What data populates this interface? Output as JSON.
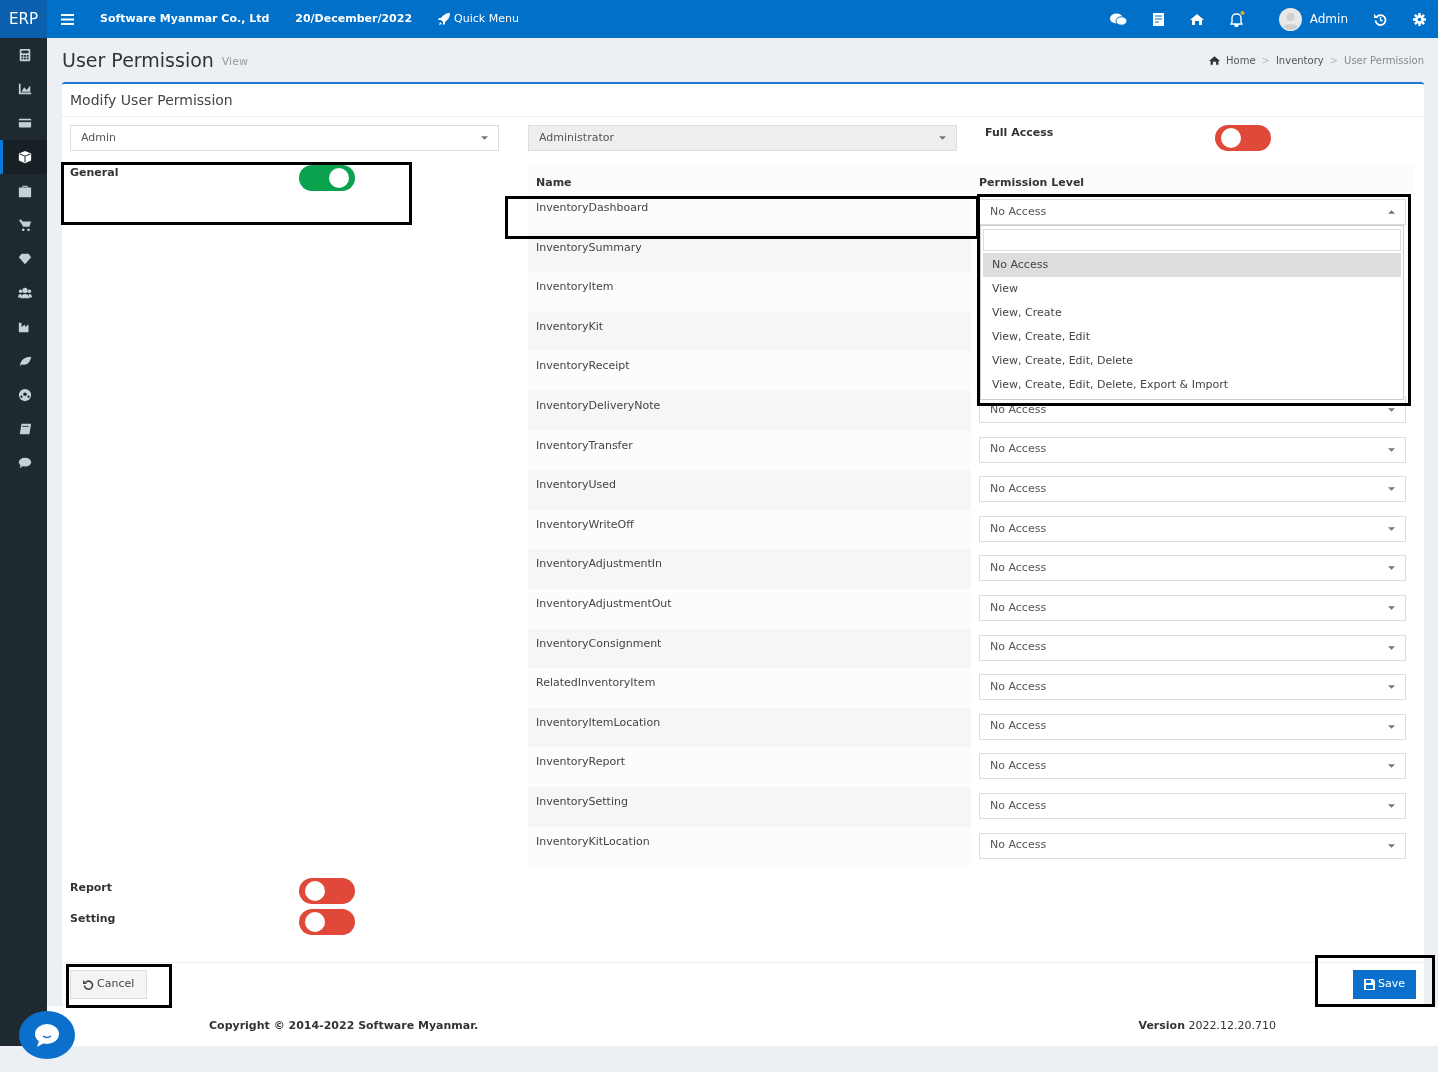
{
  "topbar": {
    "logo": "ERP",
    "company": "Software Myanmar Co., Ltd",
    "date": "20/December/2022",
    "quick_menu": "Quick Menu",
    "user": "Admin"
  },
  "sidebar": {
    "items": [
      {
        "kind": "calculator",
        "selected": false
      },
      {
        "kind": "chart",
        "selected": false
      },
      {
        "kind": "card",
        "selected": false
      },
      {
        "kind": "cube",
        "selected": true
      },
      {
        "kind": "briefcase",
        "selected": false
      },
      {
        "kind": "cart",
        "selected": false
      },
      {
        "kind": "diamond",
        "selected": false
      },
      {
        "kind": "users",
        "selected": false
      },
      {
        "kind": "factory",
        "selected": false
      },
      {
        "kind": "leaf",
        "selected": false
      },
      {
        "kind": "ball",
        "selected": false
      },
      {
        "kind": "book",
        "selected": false
      },
      {
        "kind": "comment",
        "selected": false
      }
    ]
  },
  "page": {
    "title": "User Permission",
    "subtitle": "View",
    "breadcrumb": [
      "Home",
      "Inventory",
      "User Permission"
    ],
    "breadcrumb_separators": [
      ">",
      ">"
    ]
  },
  "form": {
    "title": "Modify User Permission",
    "user_select": "Admin",
    "role_select": "Administrator",
    "full_access": {
      "label": "Full Access",
      "on": false
    },
    "modules": [
      {
        "label": "General",
        "on": true
      }
    ],
    "bottom_modules": [
      {
        "label": "Report",
        "on": false
      },
      {
        "label": "Setting",
        "on": false
      }
    ]
  },
  "table": {
    "columns": [
      "Name",
      "Permission Level"
    ],
    "rows": [
      {
        "name": "InventoryDashboard",
        "permission": "No Access",
        "expanded": true
      },
      {
        "name": "InventorySummary"
      },
      {
        "name": "InventoryItem"
      },
      {
        "name": "InventoryKit"
      },
      {
        "name": "InventoryReceipt"
      },
      {
        "name": "InventoryDeliveryNote",
        "permission": "No Access",
        "expanded": false
      },
      {
        "name": "InventoryTransfer",
        "permission": "No Access",
        "expanded": false
      },
      {
        "name": "InventoryUsed",
        "permission": "No Access",
        "expanded": false
      },
      {
        "name": "InventoryWriteOff",
        "permission": "No Access",
        "expanded": false
      },
      {
        "name": "InventoryAdjustmentIn",
        "permission": "No Access",
        "expanded": false
      },
      {
        "name": "InventoryAdjustmentOut",
        "permission": "No Access",
        "expanded": false
      },
      {
        "name": "InventoryConsignment",
        "permission": "No Access",
        "expanded": false
      },
      {
        "name": "RelatedInventoryItem",
        "permission": "No Access",
        "expanded": false
      },
      {
        "name": "InventoryItemLocation",
        "permission": "No Access",
        "expanded": false
      },
      {
        "name": "InventoryReport",
        "permission": "No Access",
        "expanded": false
      },
      {
        "name": "InventorySetting",
        "permission": "No Access",
        "expanded": false
      },
      {
        "name": "InventoryKitLocation",
        "permission": "No Access",
        "expanded": false
      }
    ],
    "dropdown_options": [
      {
        "label": "No Access",
        "selected": true
      },
      {
        "label": "View",
        "selected": false
      },
      {
        "label": "View, Create",
        "selected": false
      },
      {
        "label": "View, Create, Edit",
        "selected": false
      },
      {
        "label": "View, Create, Edit, Delete",
        "selected": false
      },
      {
        "label": "View, Create, Edit, Delete, Export & Import",
        "selected": false
      }
    ]
  },
  "buttons": {
    "cancel": "Cancel",
    "save": "Save"
  },
  "footer": {
    "copyright": "Copyright © 2014-2022",
    "link": "Software Myanmar",
    "link_suffix": ".",
    "version": "**Version** 2022.12.20.710"
  }
}
